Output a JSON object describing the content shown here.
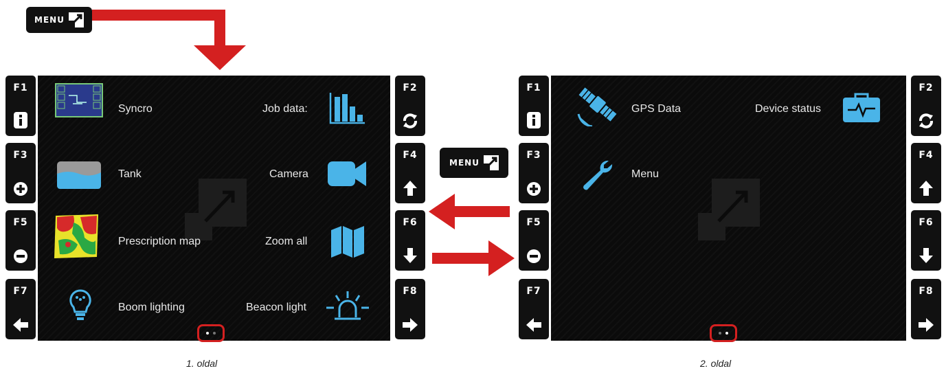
{
  "menu_badge": {
    "label": "MENU"
  },
  "fkeys": {
    "f1": "F1",
    "f2": "F2",
    "f3": "F3",
    "f4": "F4",
    "f5": "F5",
    "f6": "F6",
    "f7": "F7",
    "f8": "F8"
  },
  "page1": {
    "items": {
      "syncro": "Syncro",
      "job_data": "Job data:",
      "tank": "Tank",
      "camera": "Camera",
      "prescription_map": "Prescription map",
      "zoom_all": "Zoom all",
      "boom_lighting": "Boom lighting",
      "beacon_light": "Beacon light"
    },
    "caption": "1. oldal"
  },
  "page2": {
    "items": {
      "gps_data": "GPS Data",
      "device_status": "Device status",
      "menu": "Menu"
    },
    "caption": "2. oldal"
  },
  "colors": {
    "accent_red": "#d42020",
    "icon_blue": "#4ab4e8",
    "screen_bg": "#0b0b0b"
  },
  "icons": [
    "info-icon",
    "refresh-icon",
    "plus-icon",
    "up-arrow-icon",
    "minus-icon",
    "down-arrow-icon",
    "left-arrow-icon",
    "right-arrow-icon"
  ]
}
